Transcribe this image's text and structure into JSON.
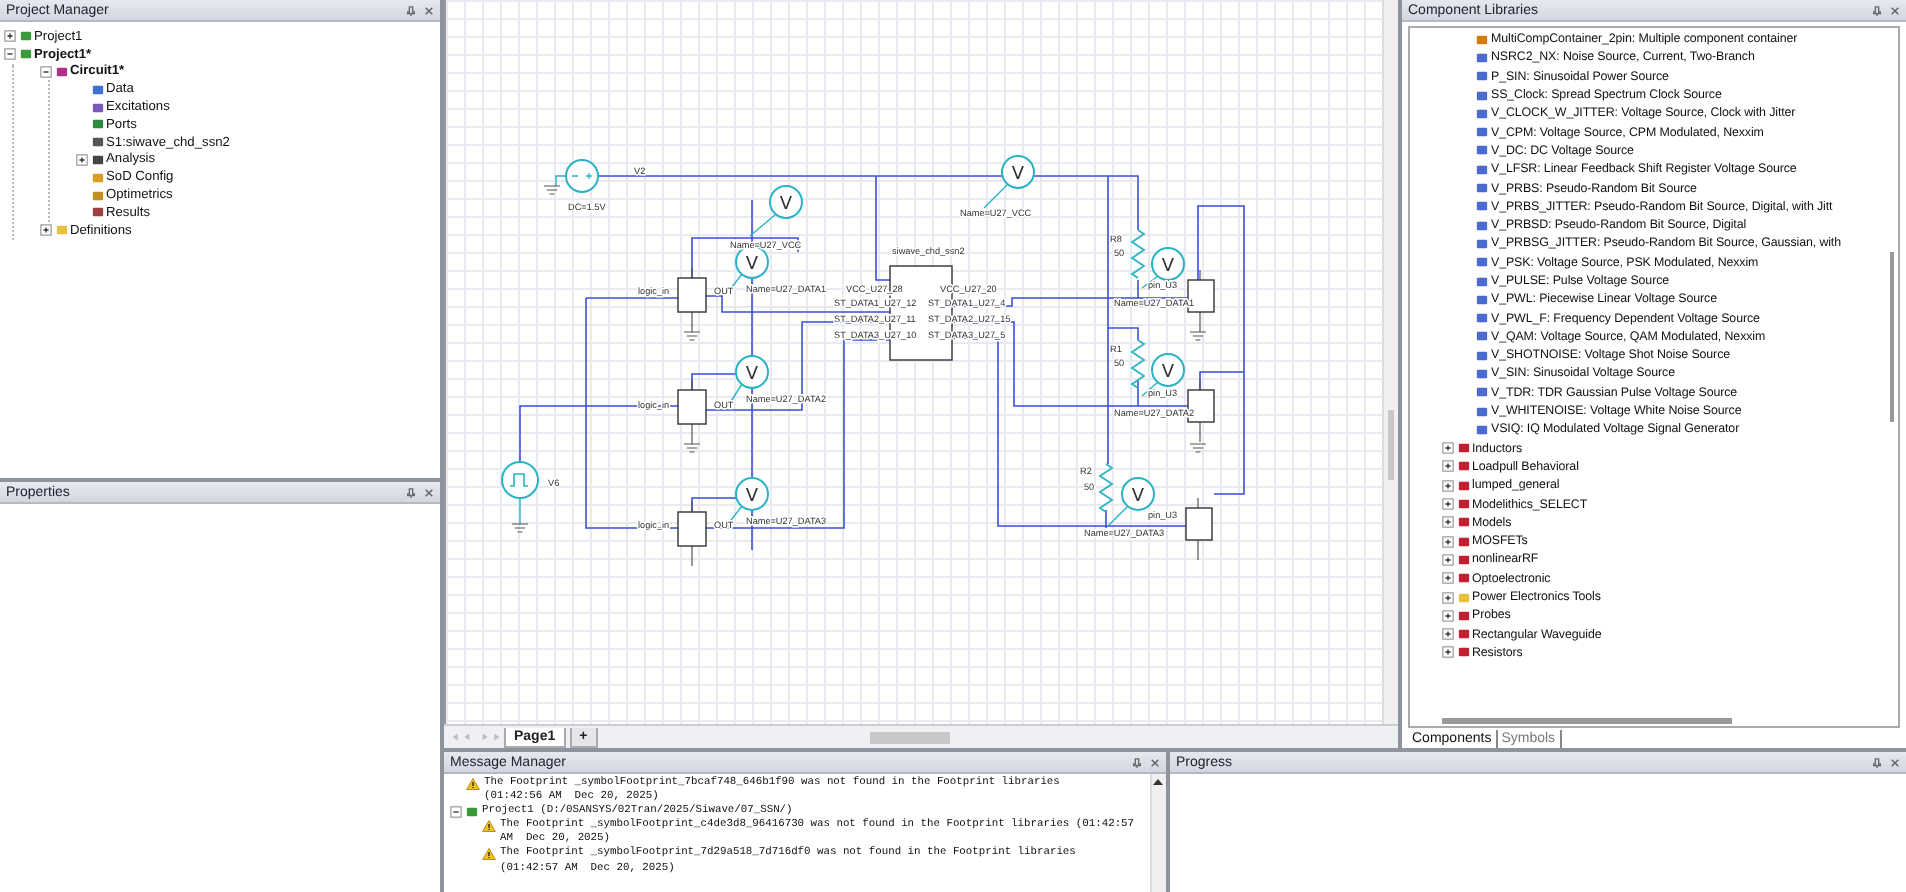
{
  "project_manager": {
    "title": "Project Manager",
    "tree": [
      {
        "label": "Project1",
        "kind": "project",
        "bold": false,
        "expanded": false
      },
      {
        "label": "Project1*",
        "kind": "project",
        "bold": true,
        "expanded": true,
        "children": [
          {
            "label": "Circuit1*",
            "kind": "circuit",
            "bold": true,
            "expanded": true,
            "children": [
              {
                "label": "Data",
                "kind": "data",
                "bold": false
              },
              {
                "label": "Excitations",
                "kind": "excitations",
                "bold": false
              },
              {
                "label": "Ports",
                "kind": "ports",
                "bold": false
              },
              {
                "label": "S1:siwave_chd_ssn2",
                "kind": "subcircuit",
                "bold": false
              },
              {
                "label": "Analysis",
                "kind": "analysis",
                "bold": false,
                "expanded": false
              },
              {
                "label": "SoD Config",
                "kind": "config",
                "bold": false
              },
              {
                "label": "Optimetrics",
                "kind": "optimetrics",
                "bold": false
              },
              {
                "label": "Results",
                "kind": "results",
                "bold": false
              }
            ]
          },
          {
            "label": "Definitions",
            "kind": "folder",
            "bold": false,
            "expanded": false
          }
        ]
      }
    ]
  },
  "properties": {
    "title": "Properties"
  },
  "schematic": {
    "labels": [
      "V2",
      "DC=1.5V",
      "Name=U27_VCC",
      "logic_in",
      "OUT",
      "Name=U27_DATA1",
      "logic_in",
      "OUT",
      "Name=U27_DATA2",
      "logic_in",
      "OUT",
      "Name=U27_DATA3",
      "V6",
      "siwave_chd_ssn2",
      "VCC_U27_28",
      "ST_DATA1_U27_12",
      "ST_DATA2_U27_11",
      "ST_DATA3_U27_10",
      "VCC_U27_20",
      "ST_DATA1_U27_4",
      "ST_DATA2_U27_15",
      "ST_DATA3_U27_5",
      "Name=U27_VCC",
      "R8",
      "50",
      "pin_U3",
      "Name=U27_DATA1",
      "R1",
      "50",
      "pin_U3",
      "Name=U27_DATA2",
      "R2",
      "50",
      "pin_U3",
      "Name=U27_DATA3"
    ],
    "probes": [
      "V",
      "V",
      "V",
      "V",
      "V",
      "V",
      "V",
      "V"
    ],
    "pages": [
      {
        "label": "Page1",
        "selected": true
      },
      {
        "label": "+",
        "selected": false
      }
    ]
  },
  "component_libraries": {
    "title": "Component Libraries",
    "tree": [
      {
        "label": "MultiCompContainer_2pin: Multiple component container",
        "kind": "container"
      },
      {
        "label": "NSRC2_NX: Noise Source, Current, Two-Branch",
        "kind": "source"
      },
      {
        "label": "P_SIN: Sinusoidal Power Source",
        "kind": "source"
      },
      {
        "label": "SS_Clock: Spread Spectrum Clock Source",
        "kind": "source"
      },
      {
        "label": "V_CLOCK_W_JITTER: Voltage Source, Clock with Jitter",
        "kind": "source"
      },
      {
        "label": "V_CPM: Voltage Source, CPM Modulated, Nexxim",
        "kind": "source"
      },
      {
        "label": "V_DC: DC Voltage Source",
        "kind": "source"
      },
      {
        "label": "V_LFSR: Linear Feedback Shift Register Voltage Source",
        "kind": "source"
      },
      {
        "label": "V_PRBS: Pseudo-Random Bit Source",
        "kind": "source"
      },
      {
        "label": "V_PRBS_JITTER: Pseudo-Random Bit Source, Digital, with Jitt",
        "kind": "source"
      },
      {
        "label": "V_PRBSD: Pseudo-Random Bit Source, Digital",
        "kind": "source"
      },
      {
        "label": "V_PRBSG_JITTER: Pseudo-Random Bit Source, Gaussian, with",
        "kind": "source"
      },
      {
        "label": "V_PSK: Voltage Source, PSK Modulated, Nexxim",
        "kind": "source"
      },
      {
        "label": "V_PULSE: Pulse Voltage Source",
        "kind": "source"
      },
      {
        "label": "V_PWL: Piecewise Linear Voltage Source",
        "kind": "source"
      },
      {
        "label": "V_PWL_F: Frequency Dependent Voltage Source",
        "kind": "source"
      },
      {
        "label": "V_QAM: Voltage Source, QAM Modulated, Nexxim",
        "kind": "source"
      },
      {
        "label": "V_SHOTNOISE: Voltage Shot Noise Source",
        "kind": "source"
      },
      {
        "label": "V_SIN: Sinusoidal Voltage Source",
        "kind": "source"
      },
      {
        "label": "V_TDR: TDR Gaussian Pulse Voltage Source",
        "kind": "source"
      },
      {
        "label": "V_WHITENOISE: Voltage White Noise Source",
        "kind": "source"
      },
      {
        "label": "VSIQ: IQ Modulated Voltage Signal Generator",
        "kind": "source"
      },
      {
        "label": "Inductors",
        "kind": "category",
        "expanded": false
      },
      {
        "label": "Loadpull Behavioral",
        "kind": "category",
        "expanded": false
      },
      {
        "label": "lumped_general",
        "kind": "category",
        "expanded": false
      },
      {
        "label": "Modelithics_SELECT",
        "kind": "category",
        "expanded": false
      },
      {
        "label": "Models",
        "kind": "category",
        "expanded": false
      },
      {
        "label": "MOSFETs",
        "kind": "category",
        "expanded": false
      },
      {
        "label": "nonlinearRF",
        "kind": "category",
        "expanded": false
      },
      {
        "label": "Optoelectronic",
        "kind": "category",
        "expanded": false
      },
      {
        "label": "Power Electronics Tools",
        "kind": "folder",
        "expanded": false
      },
      {
        "label": "Probes",
        "kind": "category",
        "expanded": false
      },
      {
        "label": "Rectangular Waveguide",
        "kind": "category",
        "expanded": false
      },
      {
        "label": "Resistors",
        "kind": "category",
        "expanded": false
      }
    ],
    "tabs": [
      {
        "label": "Components",
        "selected": true
      },
      {
        "label": "Symbols",
        "selected": false
      }
    ]
  },
  "message_manager": {
    "title": "Message Manager",
    "messages": [
      {
        "kind": "warning",
        "text": "The Footprint _symbolFootprint_7bcaf748_646b1f90 was not found in the Footprint libraries (01:42:56 AM  Dec 20, 2025)"
      },
      {
        "kind": "project",
        "text": "Project1 (D:/0SANSYS/02Tran/2025/Siwave/07_SSN/)",
        "expanded": true,
        "children": [
          {
            "kind": "warning",
            "text": "The Footprint _symbolFootprint_c4de3d8_96416730 was not found in the Footprint libraries (01:42:57 AM  Dec 20, 2025)"
          },
          {
            "kind": "warning",
            "text": "The Footprint _symbolFootprint_7d29a518_7d716df0 was not found in the Footprint libraries (01:42:57 AM  Dec 20, 2025)"
          }
        ]
      }
    ]
  },
  "progress": {
    "title": "Progress"
  }
}
